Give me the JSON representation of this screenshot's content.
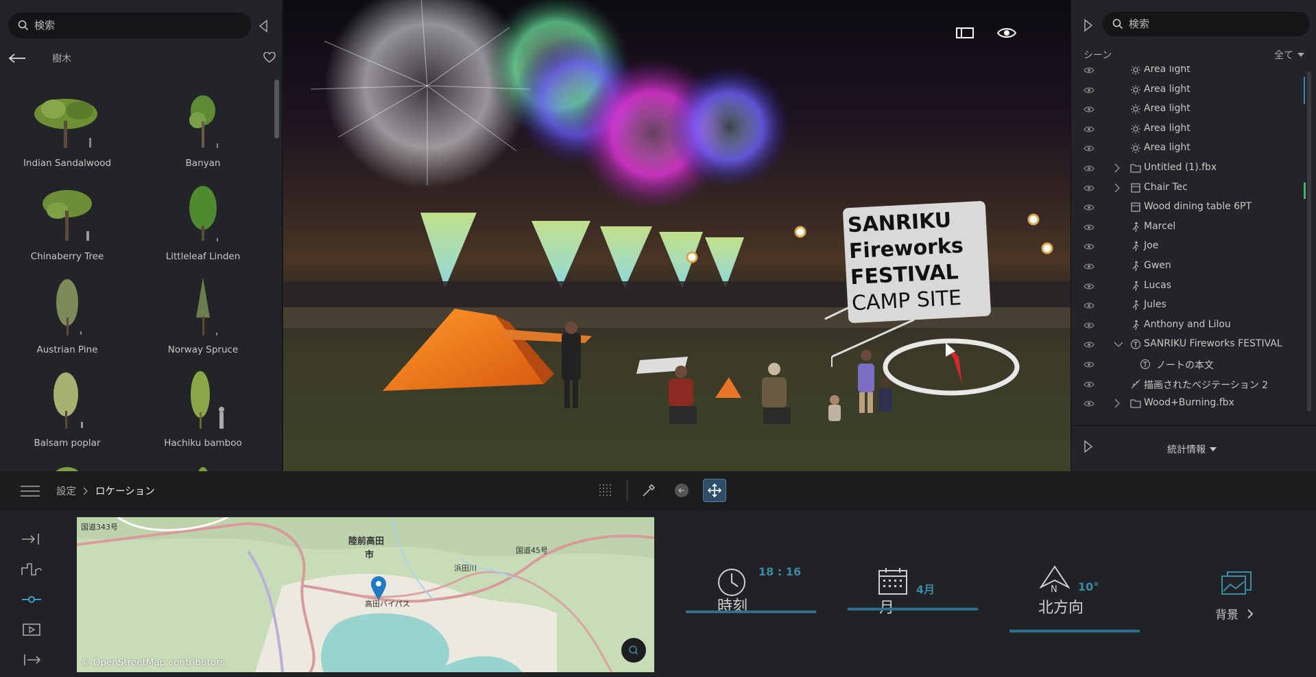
{
  "left_panel": {
    "search_placeholder": "検索",
    "category": "樹木",
    "items": [
      "Indian Sandalwood",
      "Banyan",
      "Chinaberry Tree",
      "Littleleaf Linden",
      "Austrian Pine",
      "Norway Spruce",
      "Balsam poplar",
      "Hachiku bamboo"
    ]
  },
  "viewport": {
    "sign": {
      "line1": "SANRIKU",
      "line2": "Fireworks",
      "line3": "FESTIVAL",
      "line4": "CAMP SITE"
    }
  },
  "right_panel": {
    "search_placeholder": "検索",
    "scene_label": "シーン",
    "filter_label": "全て",
    "tree": [
      {
        "label": "Area light",
        "icon": "light-icon"
      },
      {
        "label": "Area light",
        "icon": "light-icon"
      },
      {
        "label": "Area light",
        "icon": "light-icon"
      },
      {
        "label": "Area light",
        "icon": "light-icon"
      },
      {
        "label": "Area light",
        "icon": "light-icon"
      },
      {
        "label": "Untitled (1).fbx",
        "icon": "folder-icon",
        "expandable": true
      },
      {
        "label": "Chair Tec",
        "icon": "object-icon",
        "expandable": true
      },
      {
        "label": "Wood dining table 6PT",
        "icon": "object-icon"
      },
      {
        "label": "Marcel",
        "icon": "person-icon"
      },
      {
        "label": "Joe",
        "icon": "person-icon"
      },
      {
        "label": "Gwen",
        "icon": "person-icon"
      },
      {
        "label": "Lucas",
        "icon": "person-icon"
      },
      {
        "label": "Jules",
        "icon": "person-icon"
      },
      {
        "label": "Anthony and Lilou",
        "icon": "person-icon"
      },
      {
        "label": "SANRIKU Fireworks FESTIVAL",
        "icon": "text-icon",
        "expanded": true
      },
      {
        "label": "ノートの本文",
        "icon": "text-icon",
        "child": true
      },
      {
        "label": "描画されたベジテーション 2",
        "icon": "vegetation-icon"
      },
      {
        "label": "Wood+Burning.fbx",
        "icon": "folder-icon",
        "expandable": true
      }
    ],
    "stats_label": "統計情報"
  },
  "midbar": {
    "breadcrumb_root": "設定",
    "breadcrumb_current": "ロケーション"
  },
  "map": {
    "credit": "© OpenStreetMap contributors",
    "labels": [
      "陸前高田",
      "市",
      "高田バイパス",
      "国道343号",
      "国道45号",
      "浜田川"
    ]
  },
  "controls": {
    "time": {
      "label": "時刻",
      "value": "18 : 16"
    },
    "month": {
      "label": "月",
      "value": "4月"
    },
    "north": {
      "label": "北方向",
      "value": "10°",
      "n_letter": "N"
    },
    "background": {
      "label": "背景"
    }
  },
  "colors": {
    "accent": "#2f6f87",
    "accent_text": "#3c8aa6"
  }
}
